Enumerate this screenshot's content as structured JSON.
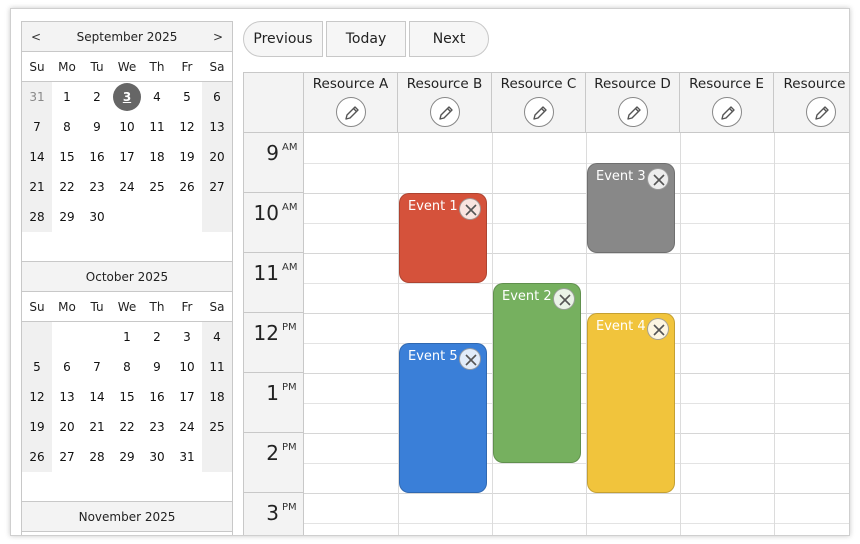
{
  "navigator": {
    "prev_label": "<",
    "next_label": ">",
    "dow": [
      "Su",
      "Mo",
      "Tu",
      "We",
      "Th",
      "Fr",
      "Sa"
    ],
    "months": [
      {
        "title": "September 2025",
        "weeks": [
          [
            "31",
            "1",
            "2",
            "3",
            "4",
            "5",
            "6"
          ],
          [
            "7",
            "8",
            "9",
            "10",
            "11",
            "12",
            "13"
          ],
          [
            "14",
            "15",
            "16",
            "17",
            "18",
            "19",
            "20"
          ],
          [
            "21",
            "22",
            "23",
            "24",
            "25",
            "26",
            "27"
          ],
          [
            "28",
            "29",
            "30",
            "",
            "",
            "",
            ""
          ]
        ],
        "other_month_first_week": true,
        "today": "3"
      },
      {
        "title": "October 2025",
        "weeks": [
          [
            "",
            "",
            "",
            "1",
            "2",
            "3",
            "4"
          ],
          [
            "5",
            "6",
            "7",
            "8",
            "9",
            "10",
            "11"
          ],
          [
            "12",
            "13",
            "14",
            "15",
            "16",
            "17",
            "18"
          ],
          [
            "19",
            "20",
            "21",
            "22",
            "23",
            "24",
            "25"
          ],
          [
            "26",
            "27",
            "28",
            "29",
            "30",
            "31",
            ""
          ]
        ]
      },
      {
        "title": "November 2025",
        "weeks": []
      }
    ]
  },
  "toolbar": {
    "previous_label": "Previous",
    "today_label": "Today",
    "next_label": "Next"
  },
  "scheduler": {
    "resources": [
      "Resource A",
      "Resource B",
      "Resource C",
      "Resource D",
      "Resource E",
      "Resource F"
    ],
    "hours": [
      {
        "num": "9",
        "ampm": "AM"
      },
      {
        "num": "10",
        "ampm": "AM"
      },
      {
        "num": "11",
        "ampm": "AM"
      },
      {
        "num": "12",
        "ampm": "PM"
      },
      {
        "num": "1",
        "ampm": "PM"
      },
      {
        "num": "2",
        "ampm": "PM"
      },
      {
        "num": "3",
        "ampm": "PM"
      }
    ],
    "events": [
      {
        "label": "Event 1",
        "resource": 1,
        "start": 10.0,
        "end": 11.5,
        "color": "#d5523b"
      },
      {
        "label": "Event 2",
        "resource": 2,
        "start": 11.5,
        "end": 14.5,
        "color": "#76b05f"
      },
      {
        "label": "Event 3",
        "resource": 3,
        "start": 9.5,
        "end": 11.0,
        "color": "#888888"
      },
      {
        "label": "Event 4",
        "resource": 3,
        "start": 12.0,
        "end": 15.0,
        "color": "#f1c43c"
      },
      {
        "label": "Event 5",
        "resource": 1,
        "start": 12.5,
        "end": 15.0,
        "color": "#3a7fd8"
      }
    ],
    "first_hour": 9
  }
}
